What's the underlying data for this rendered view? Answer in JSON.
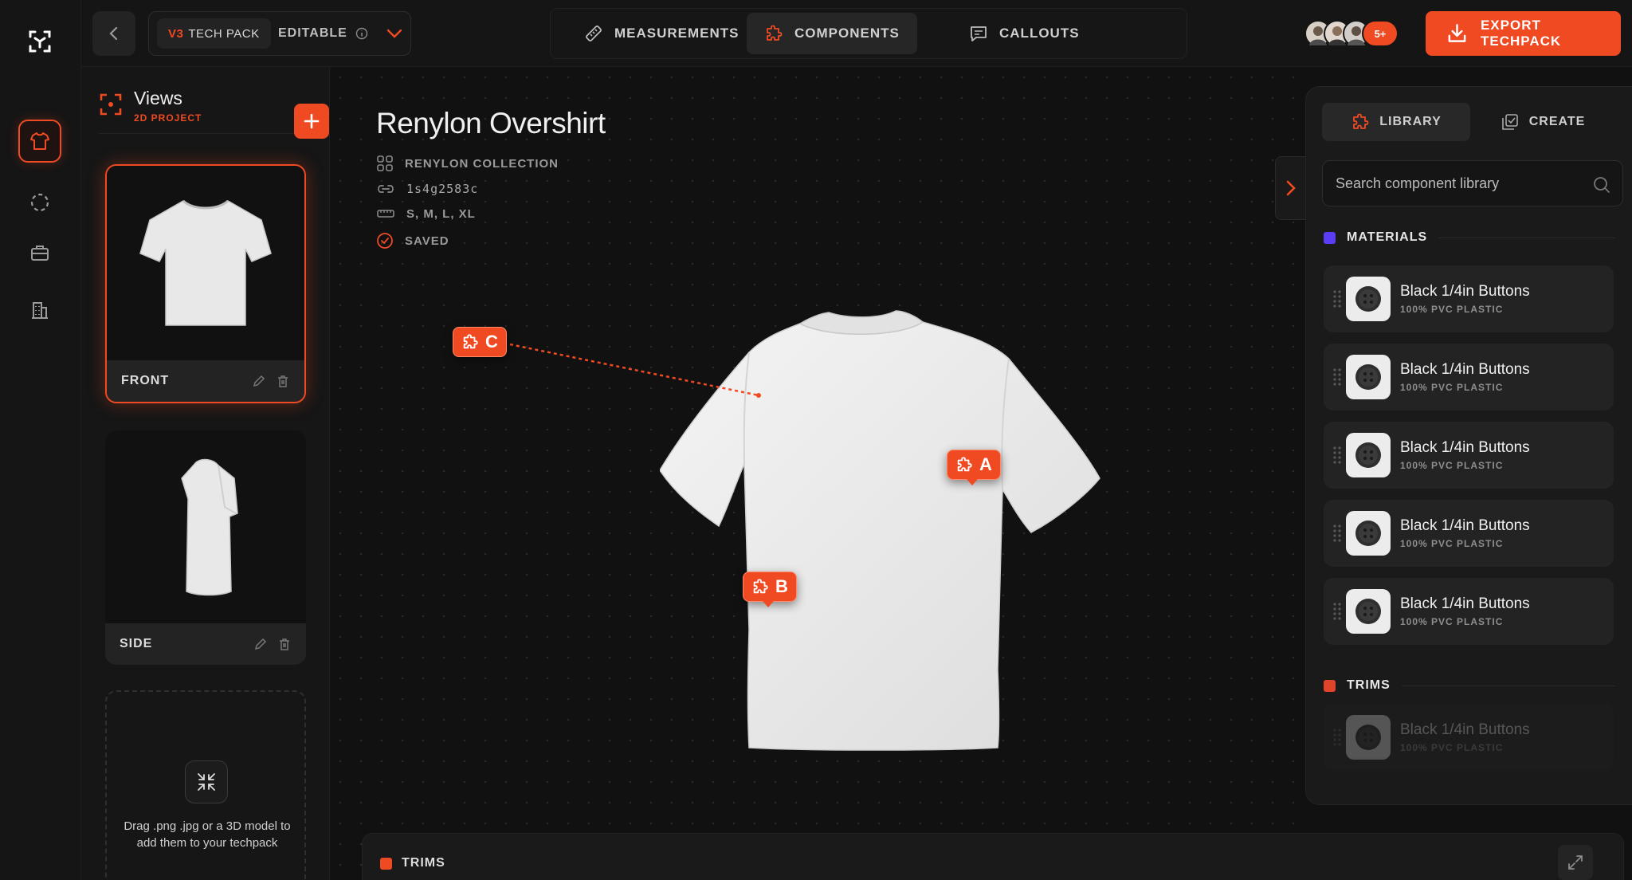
{
  "header": {
    "version": "V3",
    "version_label": "TECH PACK",
    "mode": "EDITABLE",
    "tabs": [
      {
        "label": "MEASUREMENTS",
        "icon": "ruler-icon"
      },
      {
        "label": "COMPONENTS",
        "icon": "puzzle-icon",
        "active": true
      },
      {
        "label": "CALLOUTS",
        "icon": "message-icon"
      }
    ],
    "avatars_more": "5+",
    "export_label": "EXPORT TECHPACK"
  },
  "views": {
    "title": "Views",
    "subtitle": "2D PROJECT",
    "items": [
      {
        "label": "FRONT",
        "selected": true
      },
      {
        "label": "SIDE",
        "selected": false
      }
    ],
    "dropzone_text": "Drag .png .jpg or a 3D model to add them to your techpack"
  },
  "project": {
    "title": "Renylon Overshirt",
    "collection": "RENYLON COLLECTION",
    "id": "1s4g2583c",
    "sizes": "S, M, L, XL",
    "status": "SAVED"
  },
  "pins": [
    {
      "label": "C"
    },
    {
      "label": "A"
    },
    {
      "label": "B"
    }
  ],
  "bottom_section": {
    "label": "TRIMS"
  },
  "library": {
    "tab_library": "LIBRARY",
    "tab_create": "CREATE",
    "search_placeholder": "Search component library",
    "sections": {
      "materials": {
        "label": "MATERIALS",
        "color": "#5b3df5"
      },
      "trims": {
        "label": "TRIMS",
        "color": "#e0442a"
      }
    },
    "materials": [
      {
        "name": "Black 1/4in Buttons",
        "detail": "100% PVC PLASTIC"
      },
      {
        "name": "Black 1/4in Buttons",
        "detail": "100% PVC PLASTIC"
      },
      {
        "name": "Black 1/4in Buttons",
        "detail": "100% PVC PLASTIC"
      },
      {
        "name": "Black 1/4in Buttons",
        "detail": "100% PVC PLASTIC"
      },
      {
        "name": "Black 1/4in Buttons",
        "detail": "100% PVC PLASTIC"
      }
    ],
    "trims": [
      {
        "name": "Black 1/4in Buttons",
        "detail": "100% PVC PLASTIC"
      }
    ]
  },
  "colors": {
    "accent": "#f04a23",
    "bg": "#111111",
    "panel": "#1a1a1a"
  }
}
